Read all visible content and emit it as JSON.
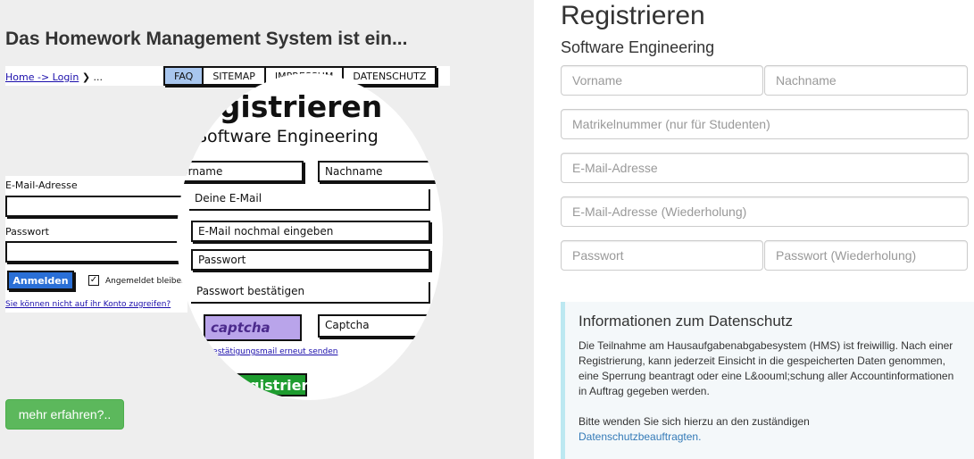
{
  "left": {
    "headline": "Das Homework Management System ist ein...",
    "sketch": {
      "breadcrumb_link": "Home -> Login",
      "breadcrumb_tail": "❯ ...",
      "nav": [
        "FAQ",
        "SITEMAP",
        "IMPRESSUM",
        "DATENSCHUTZ"
      ],
      "login_email_label": "E-Mail-Adresse",
      "login_password_label": "Passwort",
      "login_button": "Anmelden",
      "remember_label": "Angemeldet bleiben",
      "checkbox_mark": "✓",
      "forgot_link": "Sie können nicht auf ihr Konto zugreifen?",
      "reg_title": "Registrieren",
      "reg_subtitle": "Software Engineering",
      "fields": {
        "vorname": "Vorname",
        "nachname": "Nachname",
        "email": "Deine E-Mail",
        "email_repeat": "E-Mail nochmal eingeben",
        "password": "Passwort",
        "password_confirm": "Passwort bestätigen",
        "captcha": "Captcha"
      },
      "captcha_image_text": "captcha",
      "resend_link": "Bestätigungsmail erneut senden",
      "register_button": "Registrieren"
    },
    "more_button": "mehr erfahren?.."
  },
  "right": {
    "title": "Registrieren",
    "subtitle": "Software Engineering",
    "placeholders": {
      "vorname": "Vorname",
      "nachname": "Nachname",
      "matrikel": "Matrikelnummer (nur für Studenten)",
      "email": "E-Mail-Adresse",
      "email_repeat": "E-Mail-Adresse (Wiederholung)",
      "password": "Passwort",
      "password_repeat": "Passwort (Wiederholung)"
    },
    "info": {
      "title": "Informationen zum Datenschutz",
      "text": "Die Teilnahme am Hausaufgabenabgabesystem (HMS) ist freiwillig. Nach einer Registrierung, kann jederzeit Einsicht in die gespeicherten Daten genommen, eine Sperrung beantragt oder eine L&oouml;schung aller Accountinformationen in Auftrag gegeben werden.",
      "contact_prefix": "Bitte wenden Sie sich hierzu an den zuständigen",
      "contact_link": "Datenschutzbeauftragten."
    }
  },
  "colors": {
    "left_bg": "#eeeeee",
    "green_button": "#5cb85c",
    "link_blue": "#337ab7",
    "info_bg": "#f4f8fa",
    "info_border": "#bce8f1"
  }
}
